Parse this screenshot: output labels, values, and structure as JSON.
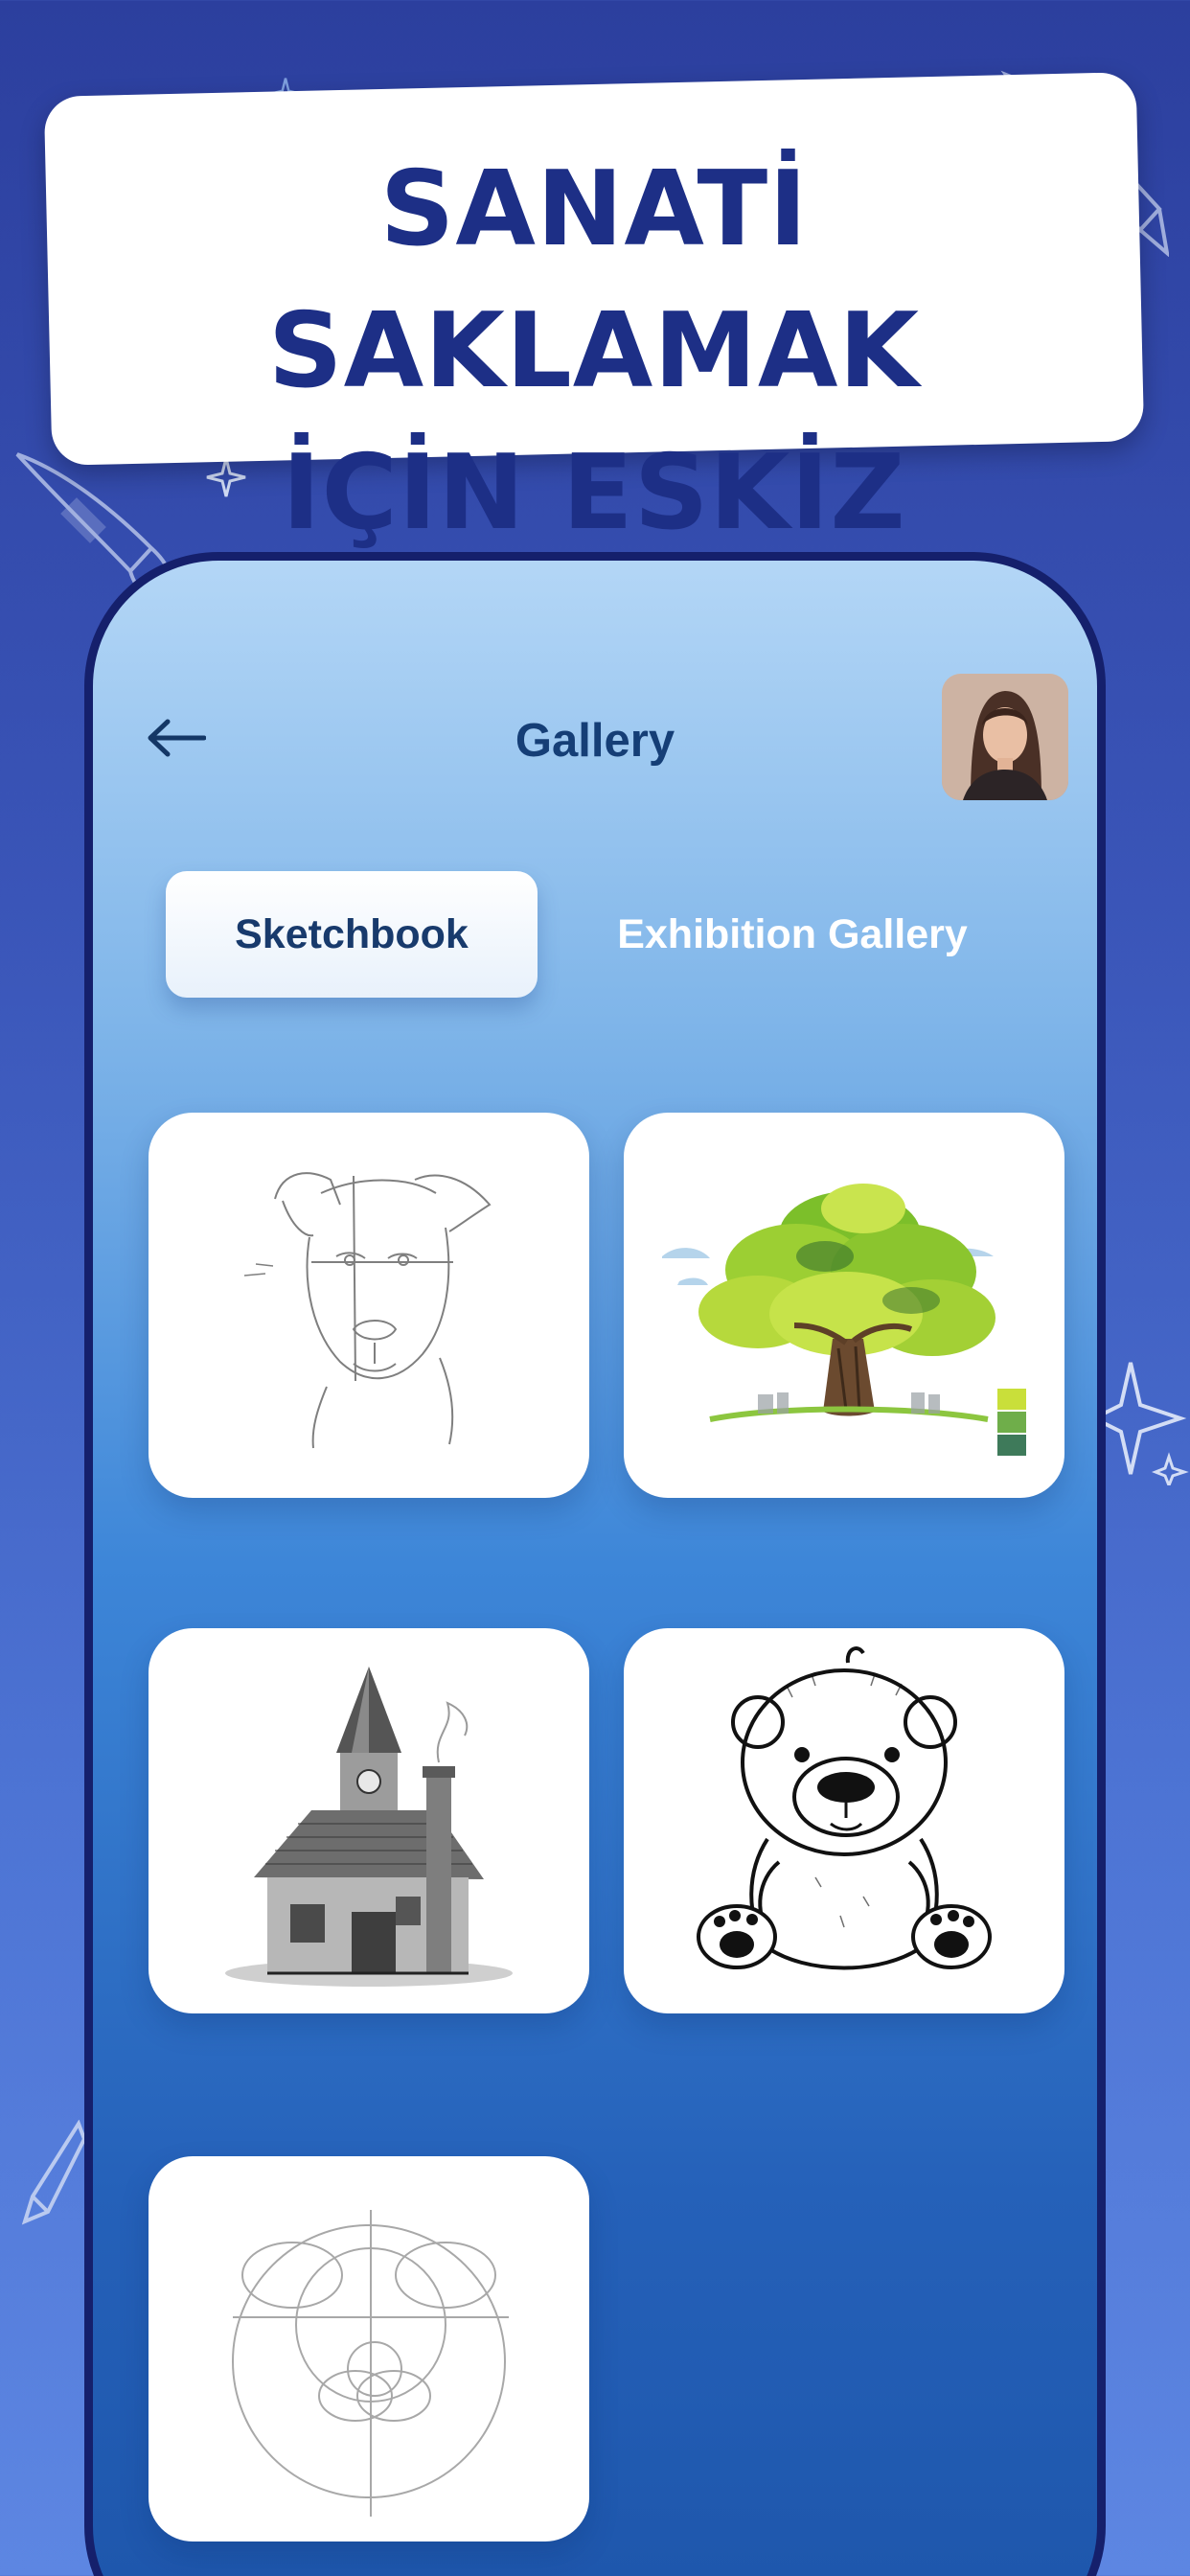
{
  "banner": {
    "line1": "SANATİ SAKLAMAK",
    "line2": "İÇİN ESKİZ"
  },
  "header": {
    "title": "Gallery",
    "back_icon": "arrow-left-icon",
    "avatar": "user-avatar"
  },
  "tabs": [
    {
      "label": "Sketchbook",
      "active": true
    },
    {
      "label": "Exhibition Gallery",
      "active": false
    }
  ],
  "gallery": {
    "items": [
      {
        "subject": "dog"
      },
      {
        "subject": "tree"
      },
      {
        "subject": "house"
      },
      {
        "subject": "teddy bear"
      },
      {
        "subject": "bear construction"
      }
    ]
  },
  "colors": {
    "background": "#3a55b8",
    "headline": "#1d2f86",
    "title": "#153e76",
    "phone_border": "#15206c"
  }
}
